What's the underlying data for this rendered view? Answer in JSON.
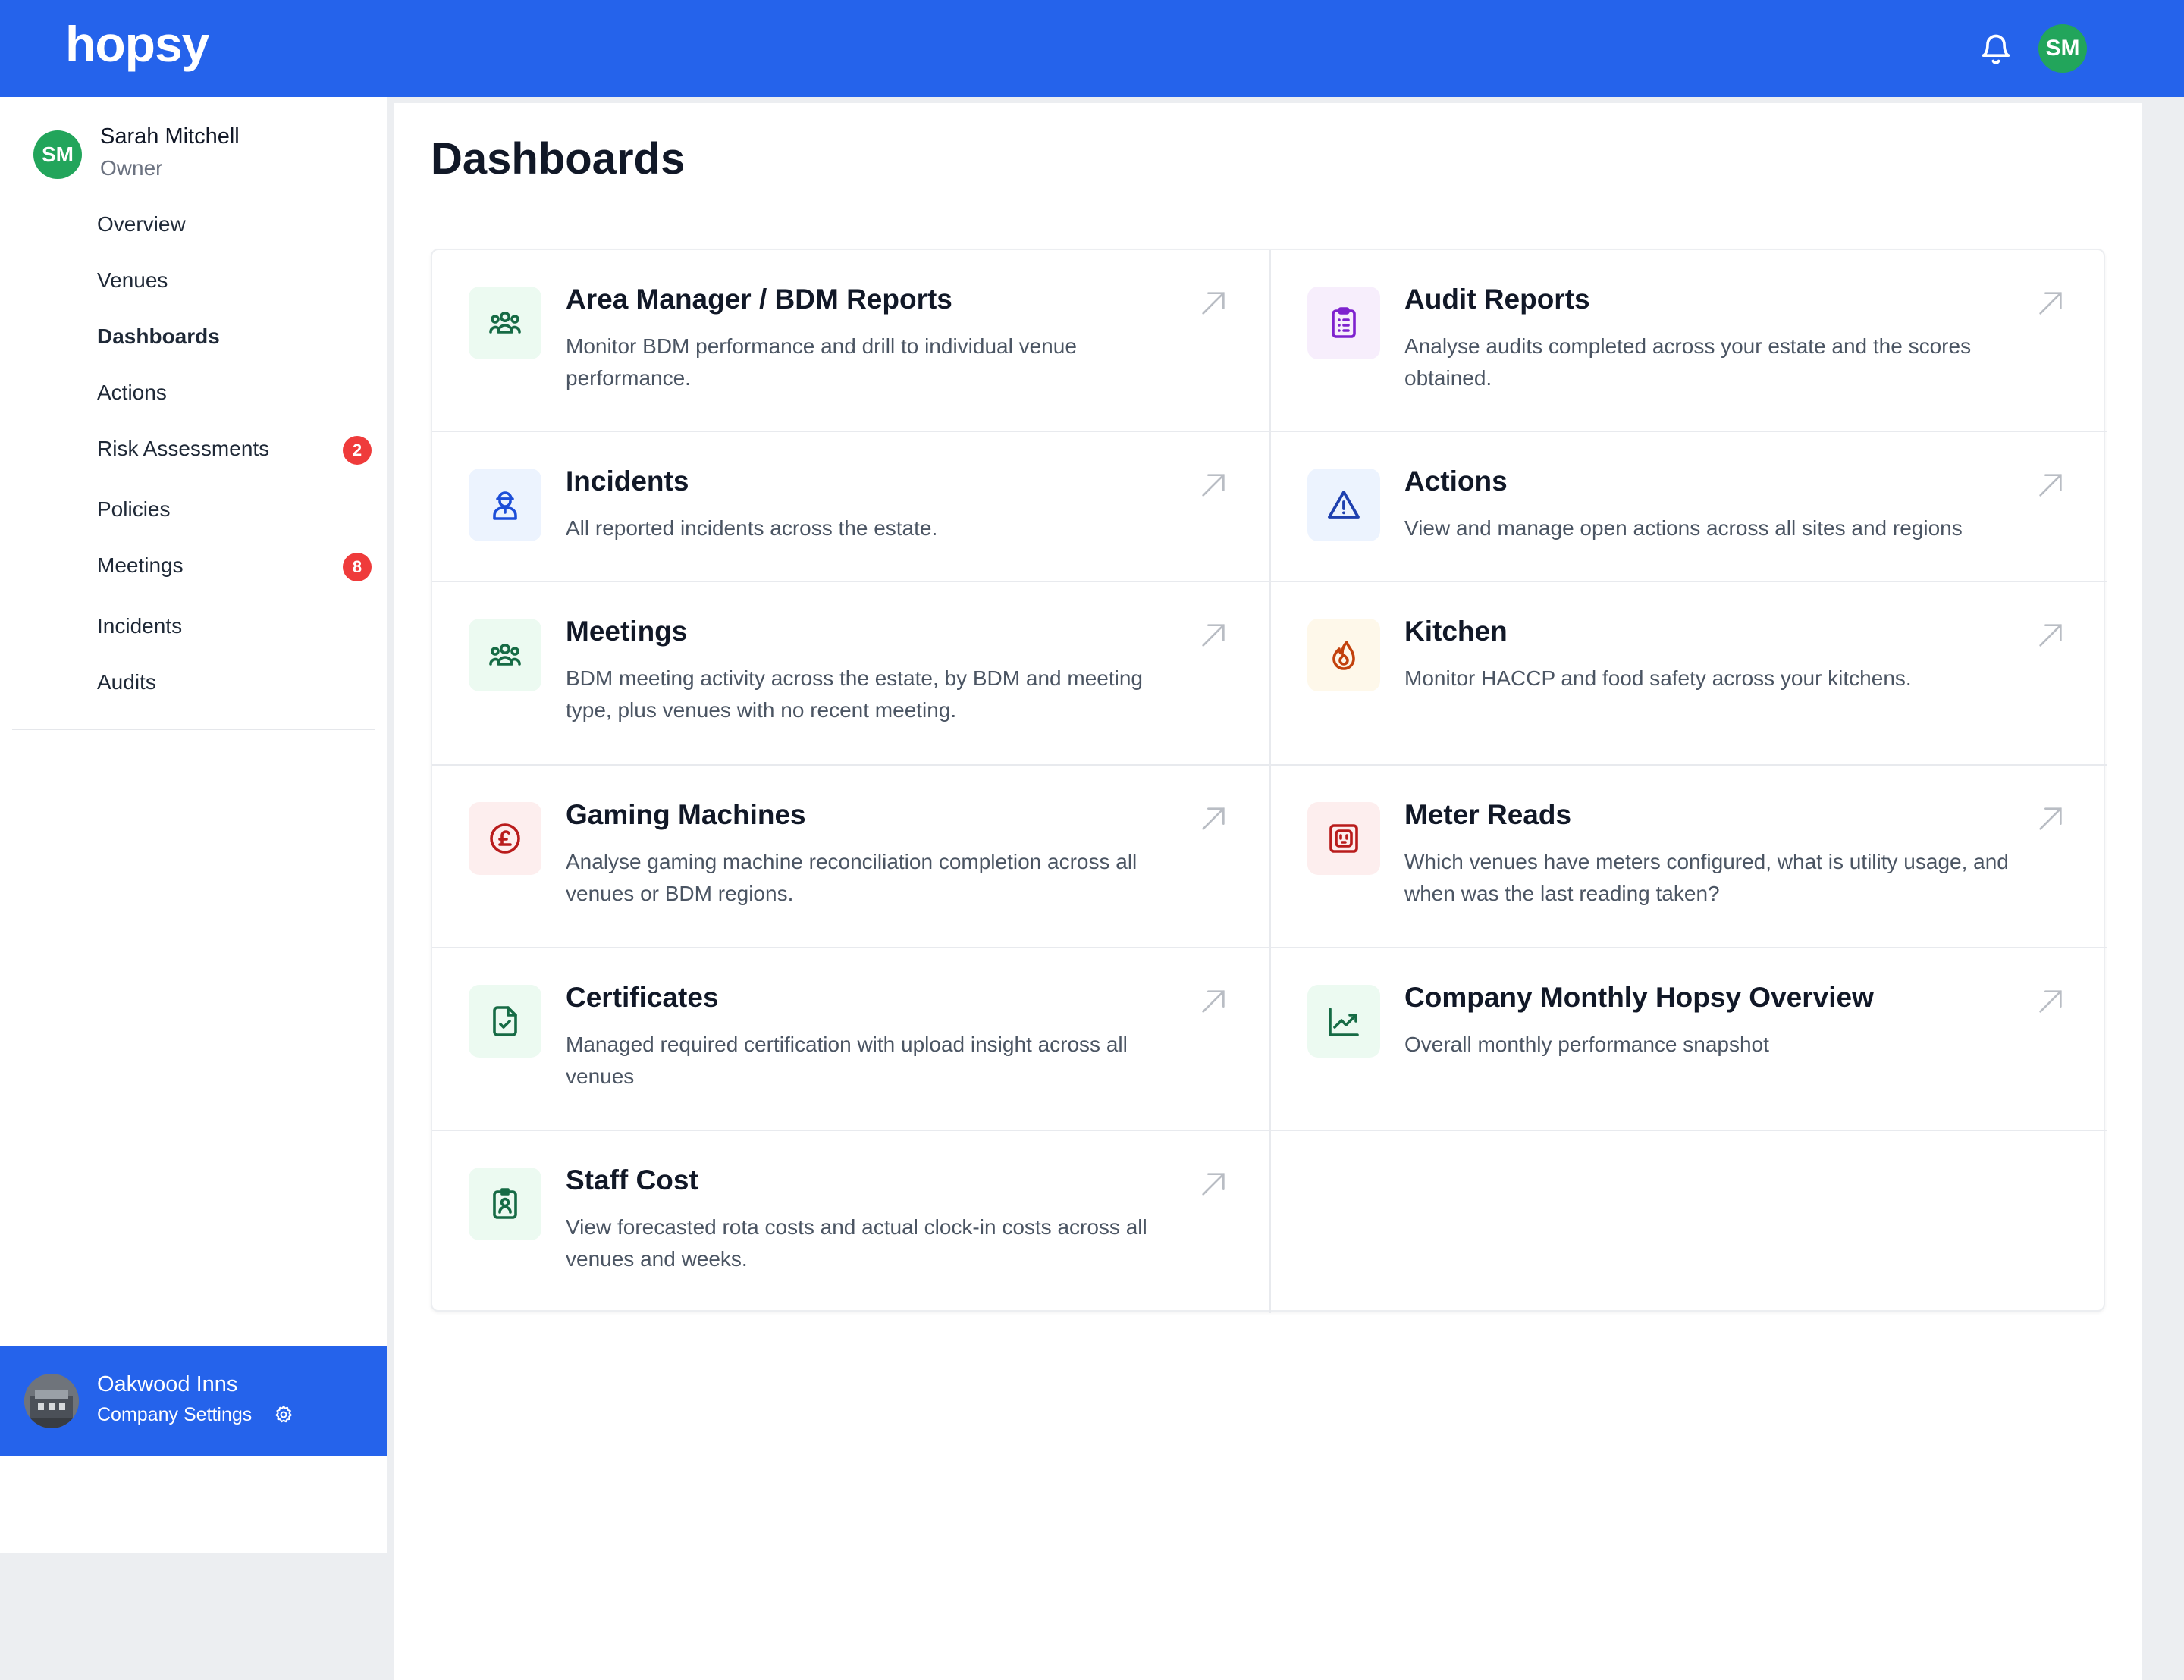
{
  "app": {
    "logo": "hopsy"
  },
  "header": {
    "avatar_initials": "SM",
    "notifications_icon": "bell-icon"
  },
  "user": {
    "initials": "SM",
    "name": "Sarah Mitchell",
    "role": "Owner"
  },
  "sidebar": {
    "items": [
      {
        "label": "Overview"
      },
      {
        "label": "Venues"
      },
      {
        "label": "Dashboards",
        "active": true
      },
      {
        "label": "Actions"
      },
      {
        "label": "Risk Assessments",
        "badge": "2"
      },
      {
        "label": "Policies"
      },
      {
        "label": "Meetings",
        "badge": "8"
      },
      {
        "label": "Incidents"
      },
      {
        "label": "Audits"
      }
    ]
  },
  "company": {
    "name": "Oakwood Inns",
    "settings_label": "Company Settings",
    "settings_icon": "gear-icon"
  },
  "main": {
    "title": "Dashboards",
    "cards": [
      {
        "title": "Area Manager / BDM Reports",
        "description": "Monitor BDM performance and drill to individual venue performance.",
        "icon": "people-group-icon",
        "bg": "#ecfaf1",
        "color": "#166b45"
      },
      {
        "title": "Audit Reports",
        "description": "Analyse audits completed across your estate and the scores obtained.",
        "icon": "clipboard-list-icon",
        "bg": "#f7eefc",
        "color": "#7e22ce"
      },
      {
        "title": "Incidents",
        "description": "All reported incidents across the estate.",
        "icon": "user-hardhat-icon",
        "bg": "#ecf3fe",
        "color": "#1d4ed8"
      },
      {
        "title": "Actions",
        "description": "View and manage open actions across all sites and regions",
        "icon": "warning-triangle-icon",
        "bg": "#ecf3fe",
        "color": "#1e40af"
      },
      {
        "title": "Meetings",
        "description": "BDM meeting activity across the estate, by BDM and meeting type, plus venues with no recent meeting.",
        "icon": "people-group-icon",
        "bg": "#ecfaf1",
        "color": "#166b45"
      },
      {
        "title": "Kitchen",
        "description": "Monitor HACCP and food safety across your kitchens.",
        "icon": "flame-icon",
        "bg": "#fef8ea",
        "color": "#c2410c"
      },
      {
        "title": "Gaming Machines",
        "description": "Analyse gaming machine reconciliation completion across all venues or BDM regions.",
        "icon": "pound-coin-icon",
        "bg": "#fdeeee",
        "color": "#b91c1c"
      },
      {
        "title": "Meter Reads",
        "description": "Which venues have meters configured, what is utility usage, and when was the last reading taken?",
        "icon": "power-socket-icon",
        "bg": "#fdeeee",
        "color": "#b91c1c"
      },
      {
        "title": "Certificates",
        "description": "Managed required certification with upload insight across all venues",
        "icon": "document-check-icon",
        "bg": "#ecfaf1",
        "color": "#166b45"
      },
      {
        "title": "Company Monthly Hopsy Overview",
        "description": "Overall monthly performance snapshot",
        "icon": "trend-chart-icon",
        "bg": "#ecfaf1",
        "color": "#166b45"
      },
      {
        "title": "Staff Cost",
        "description": "View forecasted rota costs and actual clock-in costs across all venues and weeks.",
        "icon": "id-badge-icon",
        "bg": "#ecfaf1",
        "color": "#166b45"
      }
    ]
  }
}
